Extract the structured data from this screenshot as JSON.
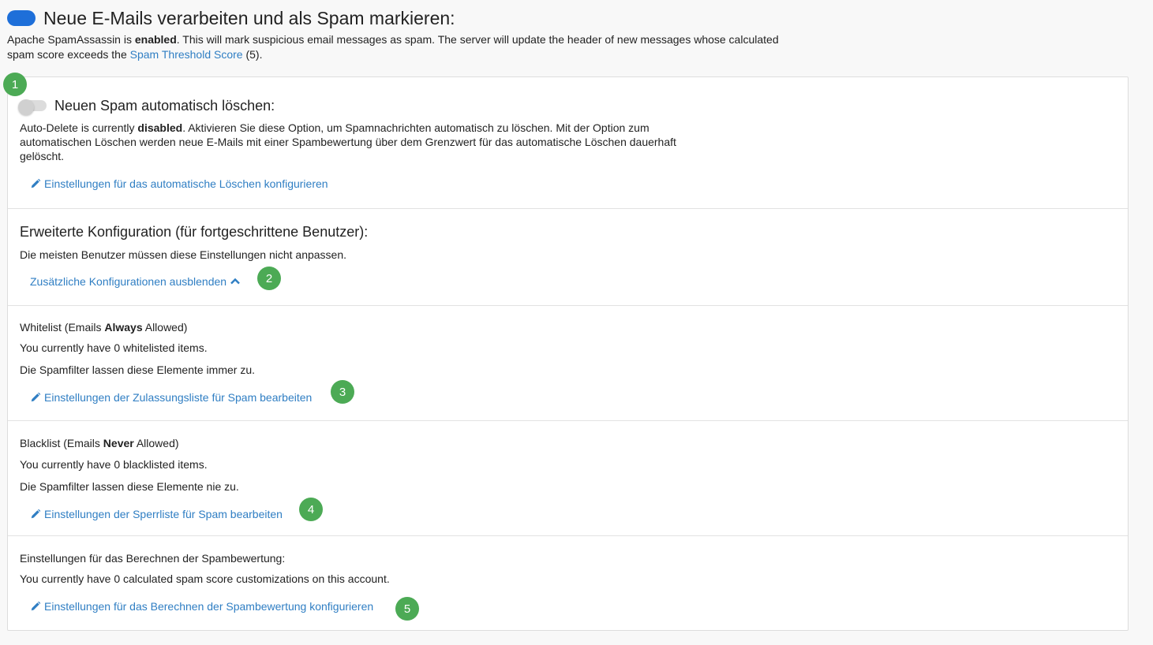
{
  "header": {
    "title": "Neue E-Mails verarbeiten und als Spam markieren:",
    "desc_prefix": "Apache SpamAssassin is ",
    "desc_bold": "enabled",
    "desc_mid": ". This will mark suspicious email messages as spam. The server will update the header of new messages whose calculated spam score exceeds the ",
    "threshold_link": "Spam Threshold Score",
    "desc_suffix": " (5).",
    "toggle_state": "on"
  },
  "autodelete": {
    "title": "Neuen Spam automatisch löschen:",
    "desc_prefix": "Auto-Delete is currently ",
    "desc_bold": "disabled",
    "desc_suffix": ". Aktivieren Sie diese Option, um Spamnachrichten automatisch zu löschen. Mit der Option zum automatischen Löschen werden neue E-Mails mit einer Spambewertung über dem Grenzwert für das automatische Löschen dauerhaft gelöscht.",
    "link": "Einstellungen für das automatische Löschen konfigurieren",
    "toggle_state": "off",
    "badge": "1"
  },
  "advanced": {
    "title": "Erweiterte Konfiguration (für fortgeschrittene Benutzer):",
    "desc": "Die meisten Benutzer müssen diese Einstellungen nicht anpassen.",
    "link": "Zusätzliche Konfigurationen ausblenden",
    "badge": "2"
  },
  "whitelist": {
    "title_prefix": "Whitelist (Emails ",
    "title_bold": "Always",
    "title_suffix": " Allowed)",
    "count": "You currently have 0 whitelisted items.",
    "desc": "Die Spamfilter lassen diese Elemente immer zu.",
    "link": "Einstellungen der Zulassungsliste für Spam bearbeiten",
    "badge": "3"
  },
  "blacklist": {
    "title_prefix": "Blacklist (Emails ",
    "title_bold": "Never",
    "title_suffix": " Allowed)",
    "count": "You currently have 0 blacklisted items.",
    "desc": "Die Spamfilter lassen diese Elemente nie zu.",
    "link": "Einstellungen der Sperrliste für Spam bearbeiten",
    "badge": "4"
  },
  "score": {
    "title": "Einstellungen für das Berechnen der Spambewertung:",
    "count": "You currently have 0 calculated spam score customizations on this account.",
    "link": "Einstellungen für das Berechnen der Spambewertung konfigurieren",
    "badge": "5"
  },
  "colors": {
    "link": "#2f7ec3",
    "toggle_on": "#1e6fd9",
    "badge": "#4caa55"
  }
}
